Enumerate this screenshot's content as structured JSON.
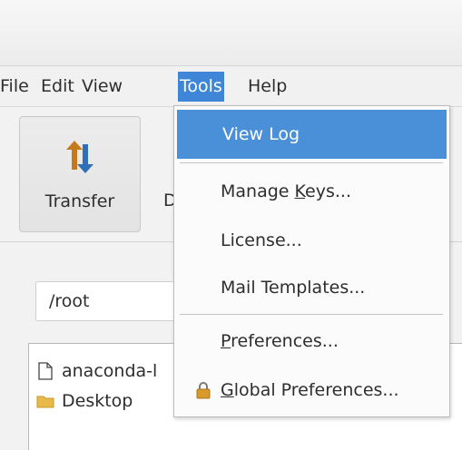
{
  "menubar": {
    "items": [
      "File",
      "Edit",
      "View",
      "Tools",
      "Help"
    ],
    "active": "Tools"
  },
  "toolbar": {
    "transfer_label": "Transfer",
    "second_label_partial": "D"
  },
  "path": {
    "value": "/root"
  },
  "files": [
    {
      "name": "anaconda-l",
      "icon": "document-icon"
    },
    {
      "name": "Desktop",
      "icon": "folder-icon"
    }
  ],
  "tools_menu": {
    "view_log": "View Log",
    "manage_keys_pre": "Manage ",
    "manage_keys_u": "K",
    "manage_keys_post": "eys...",
    "license": "License...",
    "mail_templates": "Mail Templates...",
    "preferences_u": "P",
    "preferences_post": "references...",
    "global_u": "G",
    "global_post": "lobal Preferences..."
  },
  "colors": {
    "menu_highlight": "#3f86d8",
    "item_highlight": "#4a90d9"
  }
}
